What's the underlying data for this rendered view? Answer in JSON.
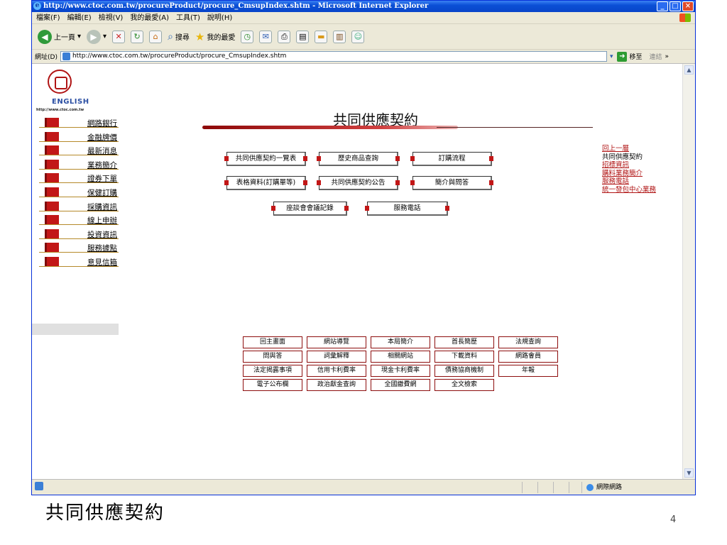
{
  "window": {
    "title": "http://www.ctoc.com.tw/procureProduct/procure_CmsupIndex.shtm - Microsoft Internet Explorer",
    "buttons": [
      "_",
      "□",
      "×"
    ]
  },
  "menu": [
    "檔案(F)",
    "編輯(E)",
    "檢視(V)",
    "我的最愛(A)",
    "工具(T)",
    "說明(H)"
  ],
  "toolbar": {
    "back_label": "上一頁",
    "search_label": "搜尋",
    "favorites_label": "我的最愛"
  },
  "address": {
    "label": "網址(D)",
    "value": "http://www.ctoc.com.tw/procureProduct/procure_CmsupIndex.shtm",
    "go_label": "移至",
    "links_label": "連結"
  },
  "page": {
    "english_label": "ENGLISH",
    "site_url": "http://www.ctoc.com.tw",
    "title": "共同供應契約",
    "sidebar": [
      "網路銀行",
      "金融牌價",
      "最新消息",
      "業務簡介",
      "證券下單",
      "保健訂購",
      "採購資訊",
      "線上申辦",
      "投資資訊",
      "服務據點",
      "意見信箱"
    ],
    "buttons_row1": [
      "共同供應契約一覽表",
      "歷史商品查詢",
      "訂購流程"
    ],
    "buttons_row2": [
      "表格資料(訂購單等)",
      "共同供應契約公告",
      "簡介與問答"
    ],
    "buttons_row3": [
      "座談會會議記錄",
      "服務電話"
    ],
    "right_links": [
      "回上一層",
      "共同供應契約",
      "招標資訊",
      "購料業務簡介",
      "服務電話",
      "統一發包中心業務"
    ],
    "footer_rows": [
      [
        "回主畫面",
        "網站導覽",
        "本局簡介",
        "首長簡歷",
        "法規查詢"
      ],
      [
        "問與答",
        "詞彙解釋",
        "相關網站",
        "下載資料",
        "網路會員"
      ],
      [
        "法定揭露事項",
        "信用卡利費率",
        "現金卡利費率",
        "債務協商機制",
        "年報"
      ],
      [
        "電子公布欄",
        "政治獻金查詢",
        "全國繳費網",
        "全文檢索"
      ]
    ]
  },
  "status": {
    "zone": "網際網路"
  },
  "slide": {
    "caption": "共同供應契約",
    "page_number": "4"
  }
}
